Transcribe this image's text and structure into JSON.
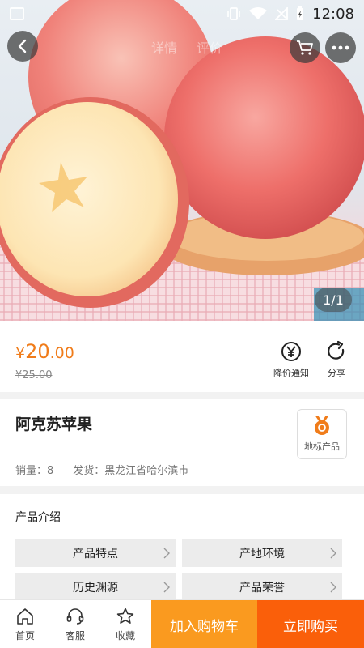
{
  "status_bar": {
    "time": "12:08"
  },
  "top_nav": {
    "tabs": [
      "详情",
      "评价"
    ]
  },
  "gallery": {
    "indicator": "1/1"
  },
  "price": {
    "currency": "¥",
    "integer": "20",
    "decimal": ".00",
    "original": "¥25.00"
  },
  "actions": {
    "notify_label": "降价通知",
    "share_label": "分享"
  },
  "product": {
    "title": "阿克苏苹果",
    "badge_label": "地标产品",
    "sales": "销量：8",
    "ship_from": "发货：黑龙江省哈尔滨市"
  },
  "intro": {
    "title": "产品介绍",
    "items": [
      "产品特点",
      "产地环境",
      "历史渊源",
      "产品荣誉"
    ]
  },
  "bottom_bar": {
    "home": "首页",
    "service": "客服",
    "favorite": "收藏",
    "add_to_cart": "加入购物车",
    "buy_now": "立即购买"
  },
  "colors": {
    "accent": "#f07c1a",
    "cart_button": "#fa9a1f",
    "buy_button": "#fa5f0a"
  },
  "icons": [
    "back-icon",
    "cart-icon",
    "more-icon",
    "price-alert-icon",
    "share-icon",
    "geo-badge-icon",
    "home-icon",
    "service-icon",
    "star-icon"
  ]
}
